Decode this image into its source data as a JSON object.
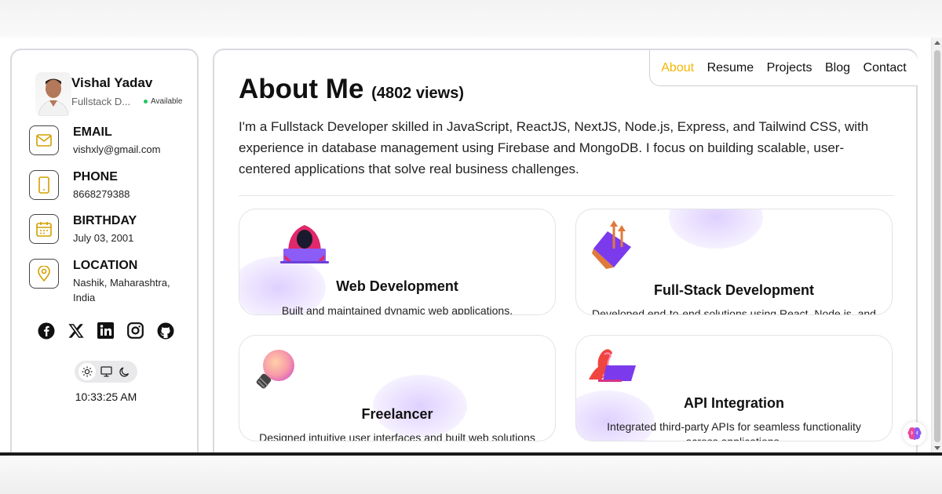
{
  "profile": {
    "name": "Vishal Yadav",
    "role": "Fullstack D...",
    "status": "Available"
  },
  "contacts": [
    {
      "label": "EMAIL",
      "value": "vishxly@gmail.com",
      "icon": "mail-icon"
    },
    {
      "label": "PHONE",
      "value": "8668279388",
      "icon": "phone-icon"
    },
    {
      "label": "BIRTHDAY",
      "value": "July 03, 2001",
      "icon": "calendar-icon"
    },
    {
      "label": "LOCATION",
      "value": "Nashik, Maharashtra, India",
      "icon": "location-pin-icon"
    }
  ],
  "socials": [
    "facebook-icon",
    "x-icon",
    "linkedin-icon",
    "instagram-icon",
    "github-icon"
  ],
  "theme_options": [
    "sun-icon",
    "monitor-icon",
    "moon-icon"
  ],
  "clock": "10:33:25 AM",
  "nav": {
    "items": [
      "About",
      "Resume",
      "Projects",
      "Blog",
      "Contact"
    ],
    "active": "About"
  },
  "about": {
    "heading": "About Me",
    "views": "(4802 views)",
    "paragraph": "I'm a Fullstack Developer skilled in JavaScript, ReactJS, NextJS, Node.js, Express, and Tailwind CSS, with experience in database management using Firebase and MongoDB. I focus on building scalable, user-centered applications that solve real business challenges."
  },
  "services": [
    {
      "title": "Web Development",
      "description": "Built and maintained dynamic web applications."
    },
    {
      "title": "Full-Stack Development",
      "description": "Developed end-to-end solutions using React, Node.js, and"
    },
    {
      "title": "Freelancer",
      "description": "Designed intuitive user interfaces and built web solutions"
    },
    {
      "title": "API Integration",
      "description": "Integrated third-party APIs for seamless functionality across applications."
    }
  ],
  "colors": {
    "accent": "#f5b700",
    "status": "#22c55e",
    "border": "#d9d9e0"
  }
}
